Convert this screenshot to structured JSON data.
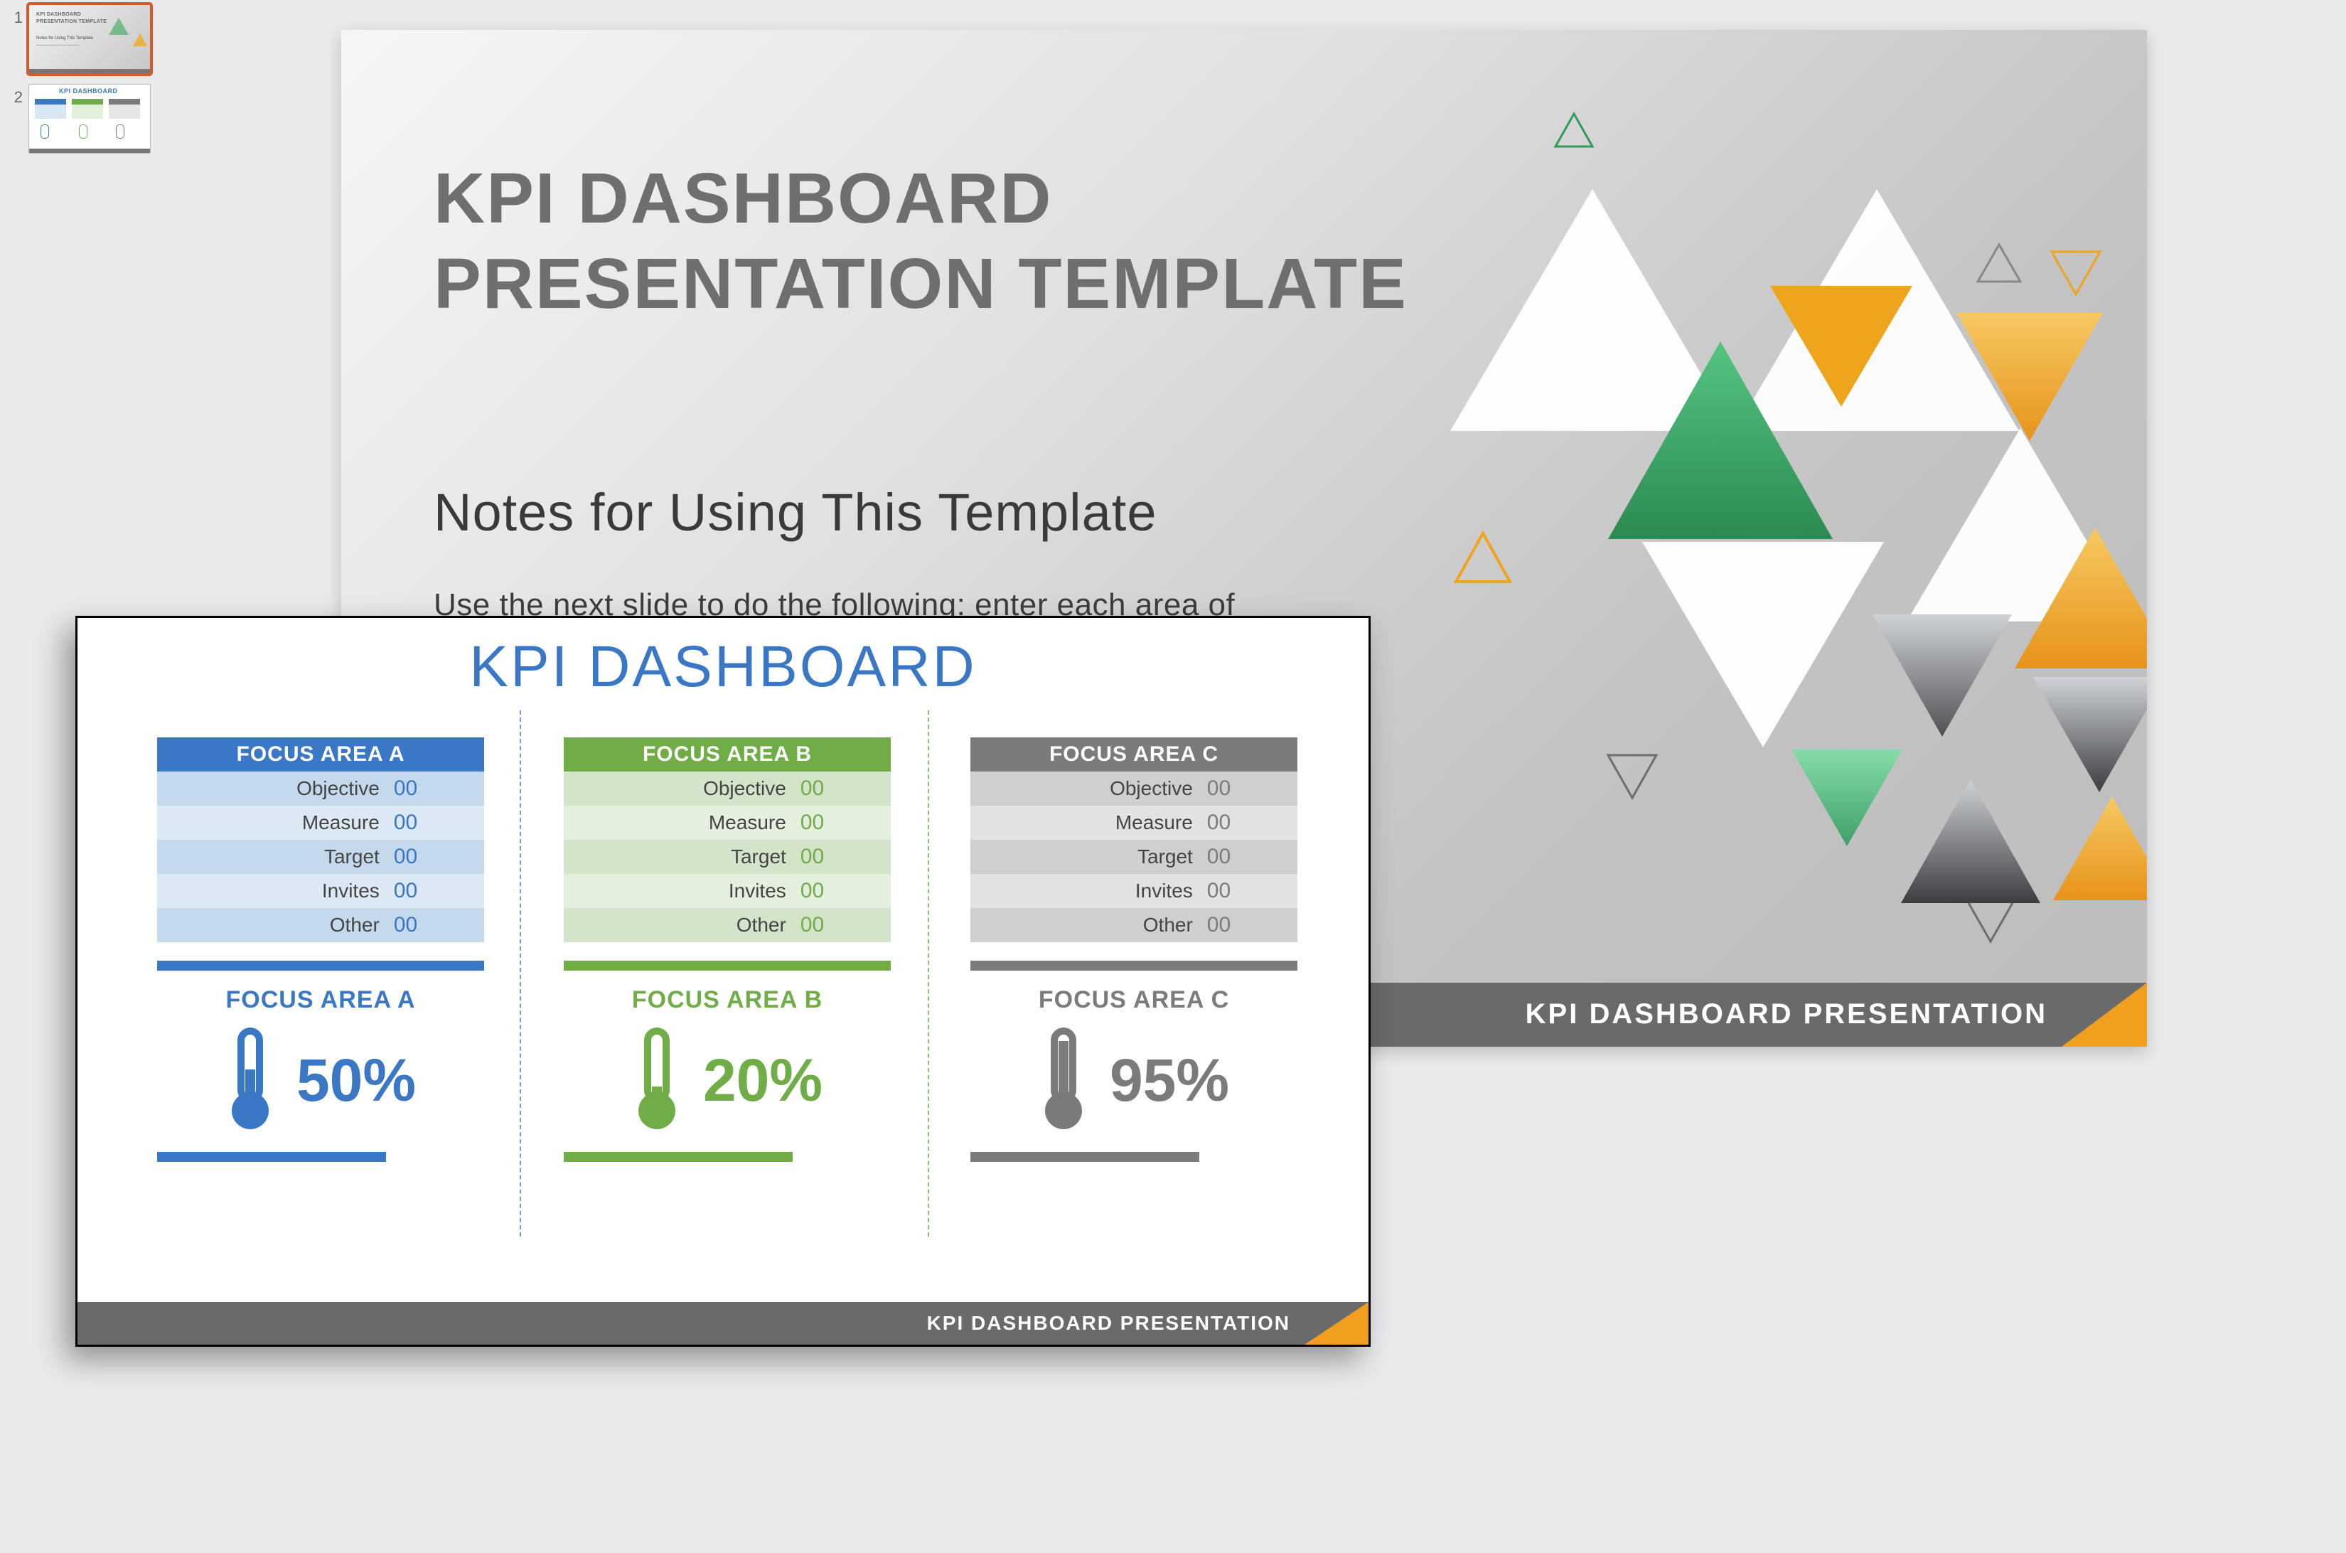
{
  "thumbnails": {
    "n1": "1",
    "n2": "2"
  },
  "mainSlide": {
    "titleLine1": "KPI DASHBOARD",
    "titleLine2": "PRESENTATION TEMPLATE",
    "subtitle": "Notes for Using This Template",
    "body": "Use the next slide to do the following: enter each area of focus: enter the percentage of success pertaining to each",
    "footer": "KPI DASHBOARD PRESENTATION"
  },
  "overlay": {
    "title": "KPI DASHBOARD",
    "footer": "KPI DASHBOARD PRESENTATION",
    "rowLabels": [
      "Objective",
      "Measure",
      "Target",
      "Invites",
      "Other"
    ],
    "colA": {
      "header": "FOCUS AREA A",
      "values": [
        "00",
        "00",
        "00",
        "00",
        "00"
      ],
      "faLabel": "FOCUS AREA A",
      "pct": "50%"
    },
    "colB": {
      "header": "FOCUS AREA B",
      "values": [
        "00",
        "00",
        "00",
        "00",
        "00"
      ],
      "faLabel": "FOCUS AREA B",
      "pct": "20%"
    },
    "colC": {
      "header": "FOCUS AREA C",
      "values": [
        "00",
        "00",
        "00",
        "00",
        "00"
      ],
      "faLabel": "FOCUS AREA C",
      "pct": "95%"
    }
  },
  "chart_data": {
    "type": "bar",
    "title": "KPI DASHBOARD",
    "categories": [
      "FOCUS AREA A",
      "FOCUS AREA B",
      "FOCUS AREA C"
    ],
    "values": [
      50,
      20,
      95
    ],
    "ylim": [
      0,
      100
    ],
    "ylabel": "Percent",
    "xlabel": ""
  },
  "colors": {
    "blue": "#3a78c5",
    "green": "#71ad47",
    "gray": "#7b7b7b",
    "orange": "#f0a01e"
  }
}
